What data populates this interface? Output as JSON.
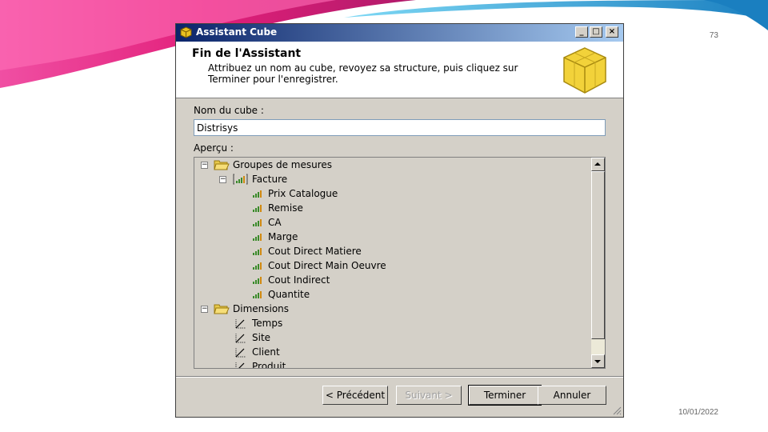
{
  "slide": {
    "page_number": "73",
    "date": "10/01/2022"
  },
  "window": {
    "title": "Assistant Cube",
    "controls": {
      "minimize": "_",
      "maximize": "□",
      "close": "×"
    }
  },
  "header": {
    "title": "Fin de l'Assistant",
    "description": "Attribuez un nom au cube, revoyez sa structure, puis cliquez sur Terminer pour l'enregistrer."
  },
  "form": {
    "name_label": "Nom du cube :",
    "name_value": "Distrisys",
    "preview_label": "Aperçu :"
  },
  "tree": {
    "measure_groups": "Groupes de mesures",
    "facture": "Facture",
    "measures": [
      "Prix Catalogue",
      "Remise",
      "CA",
      "Marge",
      "Cout Direct Matiere",
      "Cout Direct Main Oeuvre",
      "Cout Indirect",
      "Quantite"
    ],
    "dimensions": "Dimensions",
    "dimension_items": [
      "Temps",
      "Site",
      "Client",
      "Produit"
    ]
  },
  "buttons": {
    "previous": "< Précédent",
    "next": "Suivant >",
    "finish": "Terminer",
    "cancel": "Annuler"
  },
  "colors": {
    "titlebar": "#0a246a",
    "dialog": "#d4d0c8",
    "measure_icon": "#3a8a2a"
  }
}
